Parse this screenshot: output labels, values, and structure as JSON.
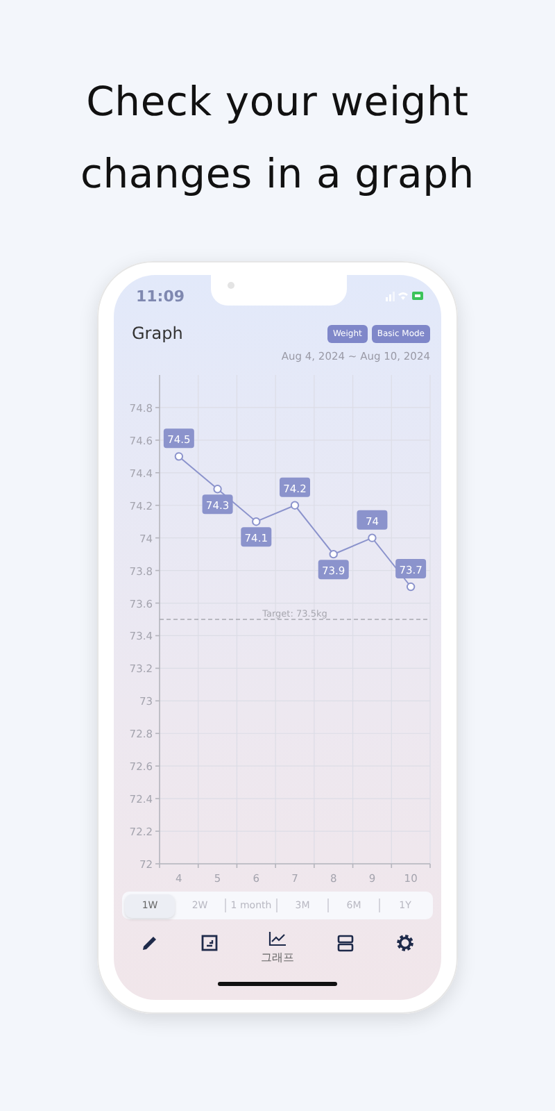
{
  "headline": [
    "Check your weight",
    "changes in a graph"
  ],
  "status_bar": {
    "time": "11:09"
  },
  "header": {
    "title": "Graph",
    "buttons": [
      "Weight",
      "Basic Mode"
    ]
  },
  "date_range": "Aug 4, 2024 ~ Aug 10, 2024",
  "chart_data": {
    "type": "line",
    "categories": [
      "4",
      "5",
      "6",
      "7",
      "8",
      "9",
      "10"
    ],
    "series": [
      {
        "color": "#8b93cc",
        "marker": "o",
        "values": [
          74.5,
          74.3,
          74.1,
          74.2,
          73.9,
          74,
          73.7
        ]
      }
    ],
    "grid": true,
    "ylim": [
      72,
      75
    ],
    "yticks": [
      72,
      72.2,
      72.4,
      72.6,
      72.8,
      73,
      73.2,
      73.4,
      73.6,
      73.8,
      74,
      74.2,
      74.4,
      74.6,
      74.8
    ],
    "data_labels": true,
    "ref_lines": [
      {
        "axis": "y",
        "value": 73.5,
        "label": "Target: 73.5kg"
      }
    ]
  },
  "periods": [
    {
      "label": "1W",
      "selected": true
    },
    {
      "label": "2W",
      "selected": false
    },
    {
      "label": "1 month",
      "selected": false
    },
    {
      "label": "3M",
      "selected": false
    },
    {
      "label": "6M",
      "selected": false
    },
    {
      "label": "1Y",
      "selected": false
    }
  ],
  "nav": [
    {
      "selected": false
    },
    {
      "selected": false
    },
    {
      "label": "그래프",
      "selected": true
    },
    {
      "selected": false
    },
    {
      "selected": false
    }
  ]
}
